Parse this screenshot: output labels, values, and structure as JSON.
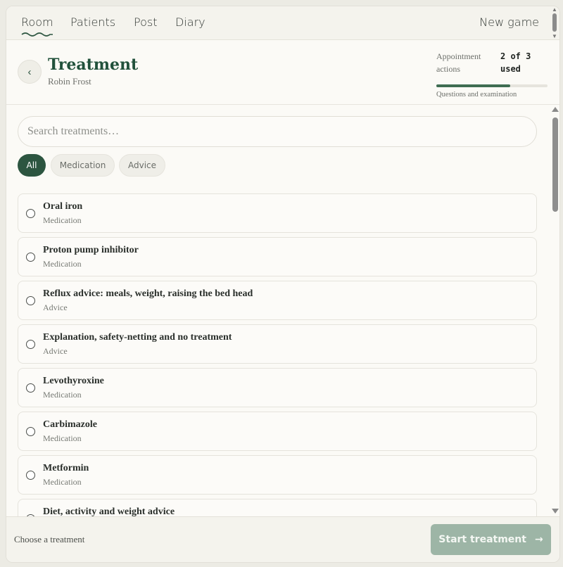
{
  "nav": {
    "tabs": [
      {
        "label": "Room"
      },
      {
        "label": "Patients"
      },
      {
        "label": "Post"
      },
      {
        "label": "Diary"
      }
    ],
    "new_game": "New game",
    "active_tab": "Room"
  },
  "header": {
    "back_glyph": "‹",
    "title": "Treatment",
    "patient": "Robin Frost",
    "appointment_label": "Appointment actions",
    "appointment_count": "2 of 3 used",
    "actions_used": 2,
    "actions_total": 3,
    "appointment_sub": "Questions and examination"
  },
  "search": {
    "placeholder": "Search treatments…",
    "value": ""
  },
  "filters": [
    {
      "label": "All",
      "selected": true
    },
    {
      "label": "Medication",
      "selected": false
    },
    {
      "label": "Advice",
      "selected": false
    }
  ],
  "treatments": [
    {
      "name": "Oral iron",
      "category": "Medication"
    },
    {
      "name": "Proton pump inhibitor",
      "category": "Medication"
    },
    {
      "name": "Reflux advice: meals, weight, raising the bed head",
      "category": "Advice"
    },
    {
      "name": "Explanation, safety-netting and no treatment",
      "category": "Advice"
    },
    {
      "name": "Levothyroxine",
      "category": "Medication"
    },
    {
      "name": "Carbimazole",
      "category": "Medication"
    },
    {
      "name": "Metformin",
      "category": "Medication"
    },
    {
      "name": "Diet, activity and weight advice",
      "category": ""
    }
  ],
  "footer": {
    "hint": "Choose a treatment",
    "start_label": "Start treatment",
    "start_arrow": "→"
  },
  "colors": {
    "accent": "#2c5540",
    "title": "#21513b",
    "button_disabled": "#9db5a6",
    "background": "#fbfaf6"
  }
}
